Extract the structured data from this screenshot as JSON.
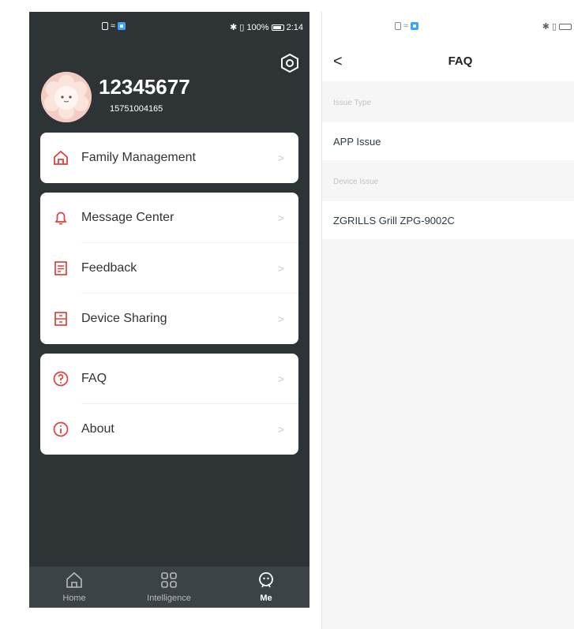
{
  "left": {
    "status": {
      "battery": "100%",
      "time": "2:14"
    },
    "profile": {
      "username": "12345677",
      "phone": "15751004165"
    },
    "menu_groups": [
      [
        {
          "label": "Family Management",
          "icon": "home-icon"
        }
      ],
      [
        {
          "label": "Message Center",
          "icon": "bell-icon"
        },
        {
          "label": "Feedback",
          "icon": "feedback-icon"
        },
        {
          "label": "Device Sharing",
          "icon": "share-icon"
        }
      ],
      [
        {
          "label": "FAQ",
          "icon": "question-icon"
        },
        {
          "label": "About",
          "icon": "info-icon"
        }
      ]
    ],
    "chevron": ">",
    "tabs": [
      {
        "label": "Home",
        "icon": "home-icon"
      },
      {
        "label": "Intelligence",
        "icon": "grid-icon"
      },
      {
        "label": "Me",
        "icon": "me-icon"
      }
    ]
  },
  "right": {
    "back": "<",
    "title": "FAQ",
    "sections": [
      {
        "header": "Issue Type",
        "items": [
          "APP Issue"
        ]
      },
      {
        "header": "Device Issue",
        "items": [
          "ZGRILLS Grill ZPG-9002C"
        ]
      }
    ]
  },
  "colors": {
    "accent": "#e0403a",
    "dark_bg": "#2e3436",
    "tabbar": "#3c4346"
  }
}
